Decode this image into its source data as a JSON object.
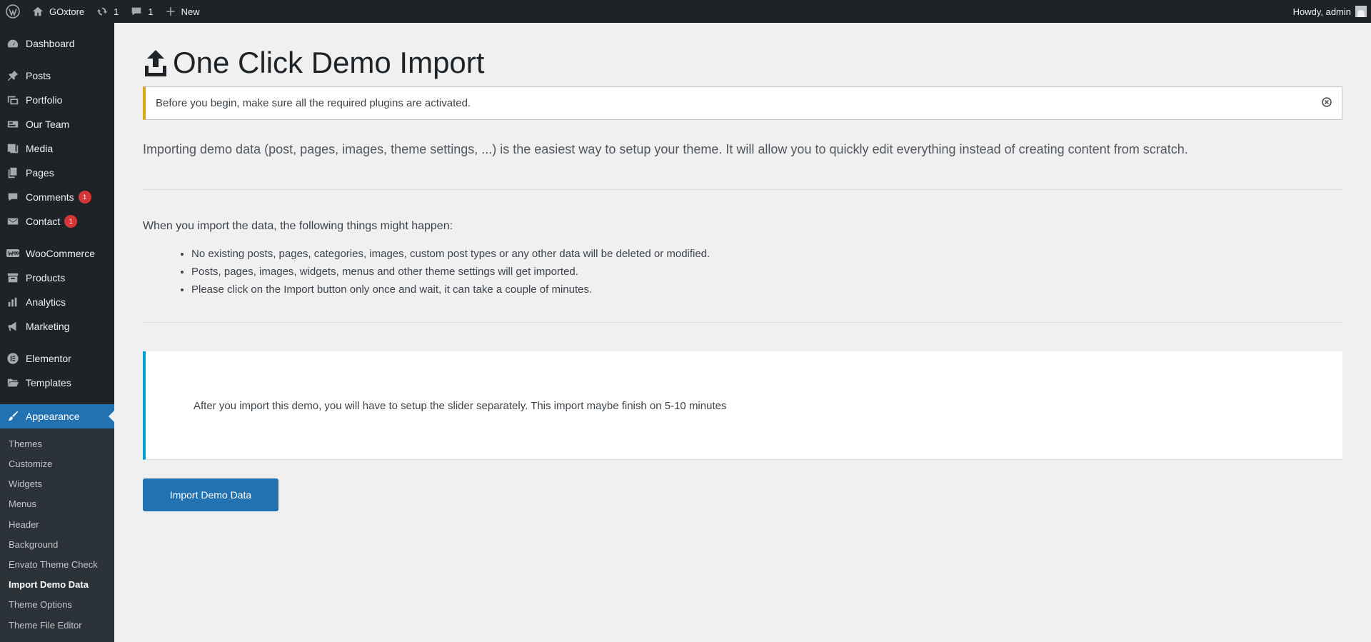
{
  "adminbar": {
    "site_name": "GOxtore",
    "updates_count": "1",
    "comments_count": "1",
    "new_label": "New",
    "howdy": "Howdy, admin"
  },
  "sidebar": {
    "items": [
      {
        "label": "Dashboard",
        "icon": "dashboard-icon"
      },
      {
        "label": "Posts",
        "icon": "pin-icon"
      },
      {
        "label": "Portfolio",
        "icon": "portfolio-icon"
      },
      {
        "label": "Our Team",
        "icon": "team-icon"
      },
      {
        "label": "Media",
        "icon": "media-icon"
      },
      {
        "label": "Pages",
        "icon": "pages-icon"
      },
      {
        "label": "Comments",
        "icon": "comment-icon",
        "badge": "1"
      },
      {
        "label": "Contact",
        "icon": "mail-icon",
        "badge": "1"
      },
      {
        "label": "WooCommerce",
        "icon": "woocommerce-icon"
      },
      {
        "label": "Products",
        "icon": "archive-icon"
      },
      {
        "label": "Analytics",
        "icon": "chart-bar-icon"
      },
      {
        "label": "Marketing",
        "icon": "megaphone-icon"
      },
      {
        "label": "Elementor",
        "icon": "elementor-icon"
      },
      {
        "label": "Templates",
        "icon": "folder-icon"
      },
      {
        "label": "Appearance",
        "icon": "paintbrush-icon"
      }
    ],
    "submenu": [
      "Themes",
      "Customize",
      "Widgets",
      "Menus",
      "Header",
      "Background",
      "Envato Theme Check",
      "Import Demo Data",
      "Theme Options",
      "Theme File Editor"
    ]
  },
  "page": {
    "title": "One Click Demo Import",
    "notice": "Before you begin, make sure all the required plugins are activated.",
    "intro": "Importing demo data (post, pages, images, theme settings, ...) is the easiest way to setup your theme. It will allow you to quickly edit everything instead of creating content from scratch.",
    "happen_title": "When you import the data, the following things might happen:",
    "happen_list": [
      "No existing posts, pages, categories, images, custom post types or any other data will be deleted or modified.",
      "Posts, pages, images, widgets, menus and other theme settings will get imported.",
      "Please click on the Import button only once and wait, it can take a couple of minutes."
    ],
    "info": "After you import this demo, you will have to setup the slider separately. This import maybe finish on 5-10 minutes",
    "import_button": "Import Demo Data"
  },
  "colors": {
    "adminbar_bg": "#1d2327",
    "accent": "#2271b1",
    "notice_warning": "#dba617",
    "info_border": "#00a0d2",
    "badge": "#d63638"
  }
}
